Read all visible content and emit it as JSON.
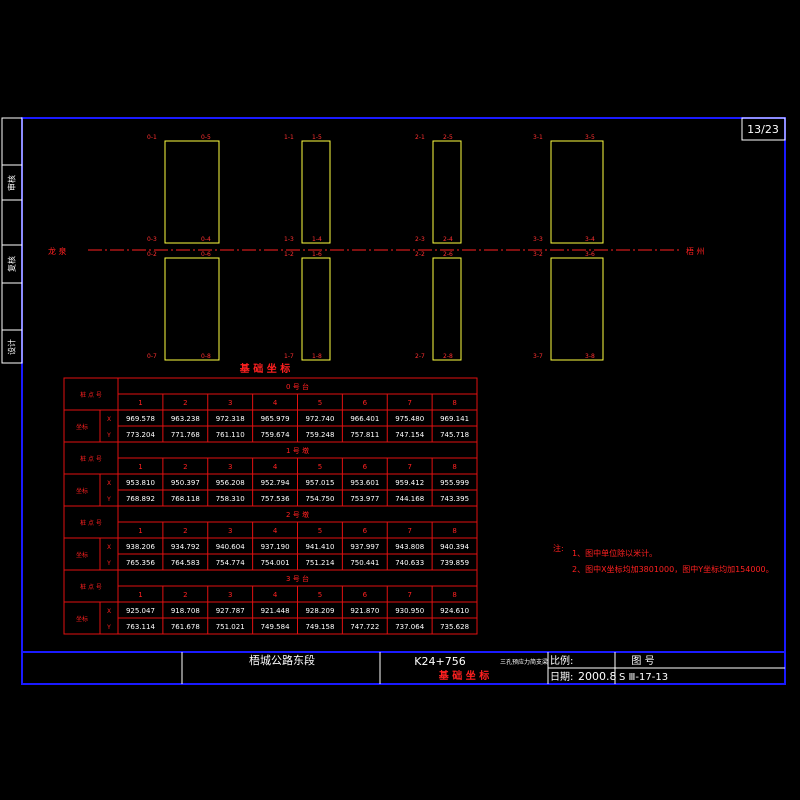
{
  "sheet": {
    "page_number": "13/23"
  },
  "side_labels": {
    "review": "审核",
    "check": "复核",
    "design": "设计"
  },
  "plan": {
    "left_label": "龙  泉",
    "right_label": "梧  州",
    "foundations": [
      {
        "id": "0",
        "corners": [
          "0-1",
          "0-5",
          "0-3",
          "0-4",
          "0-2",
          "0-6",
          "0-7",
          "0-8"
        ]
      },
      {
        "id": "1",
        "corners": [
          "1-1",
          "1-5",
          "1-3",
          "1-4",
          "1-2",
          "1-6",
          "1-7",
          "1-8"
        ]
      },
      {
        "id": "2",
        "corners": [
          "2-1",
          "2-5",
          "2-3",
          "2-4",
          "2-2",
          "2-6",
          "2-7",
          "2-8"
        ]
      },
      {
        "id": "3",
        "corners": [
          "3-1",
          "3-5",
          "3-3",
          "3-4",
          "3-2",
          "3-6",
          "3-7",
          "3-8"
        ]
      }
    ]
  },
  "table": {
    "title": "基 础 坐 标",
    "header_point": "桩 点 号",
    "header_coord": "坐标",
    "axis_x": "X",
    "axis_y": "Y",
    "columns": [
      "1",
      "2",
      "3",
      "4",
      "5",
      "6",
      "7",
      "8"
    ],
    "sections": [
      {
        "name": "0 号 台",
        "x": [
          "969.578",
          "963.238",
          "972.318",
          "965.979",
          "972.740",
          "966.401",
          "975.480",
          "969.141"
        ],
        "y": [
          "773.204",
          "771.768",
          "761.110",
          "759.674",
          "759.248",
          "757.811",
          "747.154",
          "745.718"
        ]
      },
      {
        "name": "1 号 墩",
        "x": [
          "953.810",
          "950.397",
          "956.208",
          "952.794",
          "957.015",
          "953.601",
          "959.412",
          "955.999"
        ],
        "y": [
          "768.892",
          "768.118",
          "758.310",
          "757.536",
          "754.750",
          "753.977",
          "744.168",
          "743.395"
        ]
      },
      {
        "name": "2 号 墩",
        "x": [
          "938.206",
          "934.792",
          "940.604",
          "937.190",
          "941.410",
          "937.997",
          "943.808",
          "940.394"
        ],
        "y": [
          "765.356",
          "764.583",
          "754.774",
          "754.001",
          "751.214",
          "750.441",
          "740.633",
          "739.859"
        ]
      },
      {
        "name": "3 号 台",
        "x": [
          "925.047",
          "918.708",
          "927.787",
          "921.448",
          "928.209",
          "921.870",
          "930.950",
          "924.610"
        ],
        "y": [
          "763.114",
          "761.678",
          "751.021",
          "749.584",
          "749.158",
          "747.722",
          "737.064",
          "735.628"
        ]
      }
    ]
  },
  "notes": {
    "label": "注:",
    "items": [
      "1、图中单位除以米计。",
      "2、图中X坐标均加3801000，图中Y坐标均加154000。"
    ]
  },
  "title_block": {
    "project": "梧城公路东段",
    "station": "K24+756",
    "bridge_type": "三孔预应力简支梁",
    "drawing_name": "基 础 坐 标",
    "scale_label": "比例:",
    "date_label": "日期:",
    "date_value": "2000.8",
    "drawing_no_label": "图  号",
    "drawing_no": "S Ⅲ-17-13"
  },
  "colors": {
    "frame": "#1a1aff",
    "table_line": "#e01010",
    "label_red": "#ff2020",
    "foundation": "#ffff40",
    "text": "#ffffff",
    "centerline": "#ff2020",
    "corner_label": "#ff3030"
  }
}
